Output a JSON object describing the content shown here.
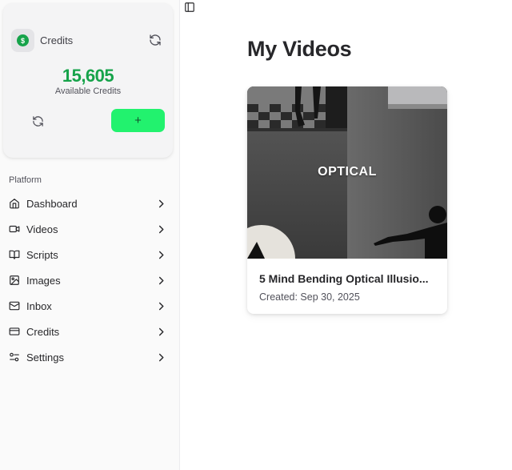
{
  "sidebar": {
    "credits": {
      "title": "Credits",
      "coin_symbol": "$",
      "amount": "15,605",
      "subtitle": "Available Credits",
      "add_symbol": "+",
      "accent_color": "#16a34a",
      "button_color": "#22f26e"
    },
    "section_label": "Platform",
    "items": [
      {
        "label": "Dashboard",
        "icon": "home-icon"
      },
      {
        "label": "Videos",
        "icon": "video-icon"
      },
      {
        "label": "Scripts",
        "icon": "book-icon"
      },
      {
        "label": "Images",
        "icon": "image-icon"
      },
      {
        "label": "Inbox",
        "icon": "mail-icon"
      },
      {
        "label": "Credits",
        "icon": "credit-card-icon"
      },
      {
        "label": "Settings",
        "icon": "settings-sliders-icon"
      }
    ]
  },
  "main": {
    "title": "My Videos",
    "videos": [
      {
        "thumbnail_text": "OPTICAL",
        "title": "5 Mind Bending Optical Illusio...",
        "created": "Created: Sep 30, 2025"
      }
    ]
  }
}
